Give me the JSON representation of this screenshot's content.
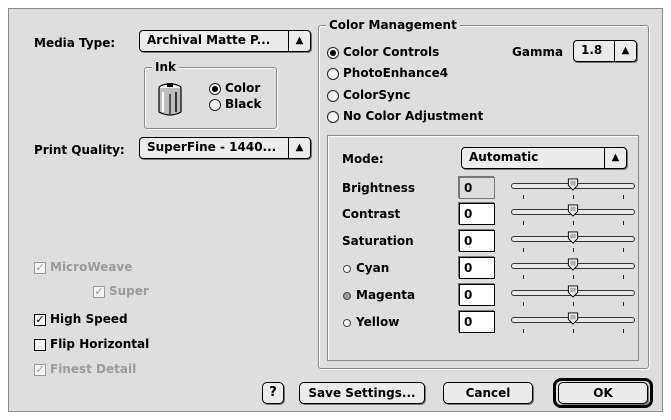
{
  "media_type": {
    "label": "Media Type:",
    "value": "Archival Matte P..."
  },
  "ink": {
    "title": "Ink",
    "options": [
      {
        "label": "Color",
        "selected": true
      },
      {
        "label": "Black",
        "selected": false
      }
    ]
  },
  "print_quality": {
    "label": "Print Quality:",
    "value": "SuperFine - 1440..."
  },
  "checkboxes": {
    "microweave": {
      "label": "MicroWeave",
      "checked": true,
      "enabled": false
    },
    "super": {
      "label": "Super",
      "checked": true,
      "enabled": false
    },
    "high_speed": {
      "label": "High Speed",
      "checked": true,
      "enabled": true
    },
    "flip_horizontal": {
      "label": "Flip Horizontal",
      "checked": false,
      "enabled": true
    },
    "finest_detail": {
      "label": "Finest Detail",
      "checked": true,
      "enabled": false
    }
  },
  "color_management": {
    "title": "Color Management",
    "options": [
      {
        "label": "Color Controls",
        "selected": true
      },
      {
        "label": "PhotoEnhance4",
        "selected": false
      },
      {
        "label": "ColorSync",
        "selected": false
      },
      {
        "label": "No Color Adjustment",
        "selected": false
      }
    ],
    "gamma": {
      "label": "Gamma",
      "value": "1.8"
    }
  },
  "mode": {
    "label": "Mode:",
    "value": "Automatic"
  },
  "adjustments": [
    {
      "label": "Brightness",
      "value": "0",
      "enabled": false,
      "dot_color": ""
    },
    {
      "label": "Contrast",
      "value": "0",
      "enabled": true,
      "dot_color": ""
    },
    {
      "label": "Saturation",
      "value": "0",
      "enabled": true,
      "dot_color": ""
    },
    {
      "label": "Cyan",
      "value": "0",
      "enabled": true,
      "dot_color": "#ffffff"
    },
    {
      "label": "Magenta",
      "value": "0",
      "enabled": true,
      "dot_color": "#9a9a9a"
    },
    {
      "label": "Yellow",
      "value": "0",
      "enabled": true,
      "dot_color": "#ffffff"
    }
  ],
  "buttons": {
    "help": "?",
    "save_settings": "Save Settings...",
    "cancel": "Cancel",
    "ok": "OK"
  },
  "icons": {
    "ink_cartridge": "ink-cartridge-icon",
    "popup_arrows": "updown-arrows-icon"
  },
  "colors": {
    "background": "#dedede",
    "border": "#8a8a8a",
    "disabled": "#9a9a9a"
  }
}
